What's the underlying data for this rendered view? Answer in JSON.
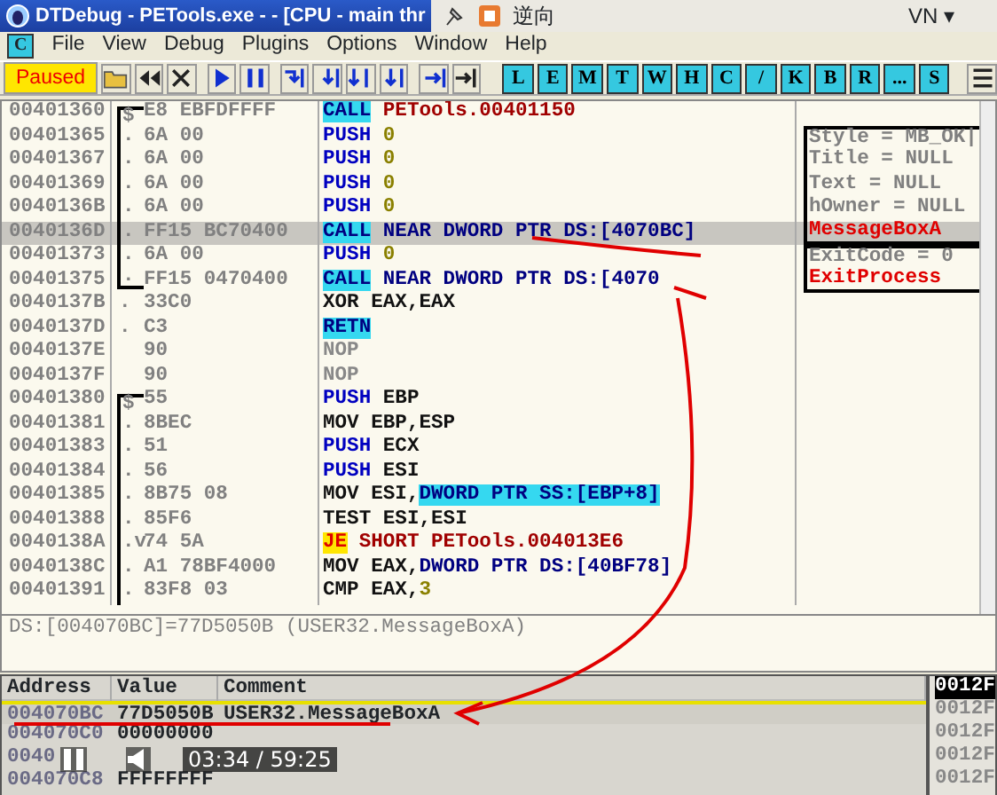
{
  "window": {
    "title": "DTDebug - PETools.exe - - [CPU - main thr",
    "overlay_tab": "逆向",
    "user_menu": "VN ▾"
  },
  "menu": [
    "File",
    "View",
    "Debug",
    "Plugins",
    "Options",
    "Window",
    "Help"
  ],
  "menu_logo": "C",
  "toolbar": {
    "status": "Paused",
    "letters": [
      "L",
      "E",
      "M",
      "T",
      "W",
      "H",
      "C",
      "/",
      "K",
      "B",
      "R",
      "...",
      "S"
    ]
  },
  "disassembly": [
    {
      "bracketed": true,
      "closed": true,
      "rows": [
        {
          "address": "00401360",
          "marker": "$",
          "hex": "E8 EBFDFFFF",
          "mnemonic": "CALL",
          "kind": "call",
          "operands": [
            {
              "text": "PETools.00401150",
              "kind": "label"
            }
          ],
          "selected": false
        },
        {
          "address": "00401365",
          "marker": ".",
          "hex": "6A 00",
          "mnemonic": "PUSH",
          "kind": "push",
          "operands": [
            {
              "text": "0",
              "kind": "imm"
            }
          ],
          "comment": {
            "text": "Style = MB_OK|",
            "kind": "arg"
          },
          "selected": false
        },
        {
          "address": "00401367",
          "marker": ".",
          "hex": "6A 00",
          "mnemonic": "PUSH",
          "kind": "push",
          "operands": [
            {
              "text": "0",
              "kind": "imm"
            }
          ],
          "comment": {
            "text": "Title = NULL",
            "kind": "arg"
          },
          "selected": false
        },
        {
          "address": "00401369",
          "marker": ".",
          "hex": "6A 00",
          "mnemonic": "PUSH",
          "kind": "push",
          "operands": [
            {
              "text": "0",
              "kind": "imm"
            }
          ],
          "comment": {
            "text": "Text = NULL",
            "kind": "arg"
          },
          "selected": false
        },
        {
          "address": "0040136B",
          "marker": ".",
          "hex": "6A 00",
          "mnemonic": "PUSH",
          "kind": "push",
          "operands": [
            {
              "text": "0",
              "kind": "imm"
            }
          ],
          "comment": {
            "text": "hOwner = NULL",
            "kind": "arg"
          },
          "selected": false
        },
        {
          "address": "0040136D",
          "marker": ".",
          "hex": "FF15 BC70400",
          "mnemonic": "CALL",
          "kind": "call",
          "operands": [
            {
              "text": "NEAR DWORD PTR DS:[4070BC]",
              "kind": "mem"
            }
          ],
          "comment": {
            "text": "MessageBoxA",
            "kind": "api"
          },
          "selected": true
        },
        {
          "address": "00401373",
          "marker": ".",
          "hex": "6A 00",
          "mnemonic": "PUSH",
          "kind": "push",
          "operands": [
            {
              "text": "0",
              "kind": "imm"
            }
          ],
          "comment": {
            "text": "ExitCode = 0",
            "kind": "arg"
          },
          "selected": false
        },
        {
          "address": "00401375",
          "marker": ".",
          "hex": "FF15 0470400",
          "mnemonic": "CALL",
          "kind": "call",
          "operands": [
            {
              "text": "NEAR DWORD PTR DS:[4070",
              "kind": "mem"
            }
          ],
          "comment": {
            "text": "ExitProcess",
            "kind": "api"
          },
          "selected": false
        }
      ]
    },
    {
      "bracketed": false,
      "rows": [
        {
          "address": "0040137B",
          "marker": ".",
          "hex": "33C0",
          "mnemonic": "XOR",
          "kind": "plain",
          "operands": [
            {
              "text": "EAX,EAX",
              "kind": "reg"
            }
          ],
          "selected": false
        },
        {
          "address": "0040137D",
          "marker": ".",
          "hex": "C3",
          "mnemonic": "RETN",
          "kind": "ret",
          "selected": false
        },
        {
          "address": "0040137E",
          "hex": "90",
          "mnemonic": "NOP",
          "kind": "nop",
          "selected": false
        },
        {
          "address": "0040137F",
          "hex": "90",
          "mnemonic": "NOP",
          "kind": "nop",
          "selected": false
        }
      ]
    },
    {
      "bracketed": true,
      "closed": false,
      "rows": [
        {
          "address": "00401380",
          "marker": "$",
          "hex": "55",
          "mnemonic": "PUSH",
          "kind": "push",
          "operands": [
            {
              "text": "EBP",
              "kind": "reg"
            }
          ],
          "selected": false
        },
        {
          "address": "00401381",
          "marker": ".",
          "hex": "8BEC",
          "mnemonic": "MOV",
          "kind": "plain",
          "operands": [
            {
              "text": "EBP,ESP",
              "kind": "reg"
            }
          ],
          "selected": false
        },
        {
          "address": "00401383",
          "marker": ".",
          "hex": "51",
          "mnemonic": "PUSH",
          "kind": "push",
          "operands": [
            {
              "text": "ECX",
              "kind": "reg"
            }
          ],
          "selected": false
        },
        {
          "address": "00401384",
          "marker": ".",
          "hex": "56",
          "mnemonic": "PUSH",
          "kind": "push",
          "operands": [
            {
              "text": "ESI",
              "kind": "reg"
            }
          ],
          "selected": false
        },
        {
          "address": "00401385",
          "marker": ".",
          "hex": "8B75 08",
          "mnemonic": "MOV",
          "kind": "plain",
          "operands": [
            {
              "text": "ESI,",
              "kind": "reg"
            },
            {
              "text": "DWORD PTR SS:[EBP+8]",
              "kind": "memhl"
            }
          ],
          "selected": false
        },
        {
          "address": "00401388",
          "marker": ".",
          "hex": "85F6",
          "mnemonic": "TEST",
          "kind": "plain",
          "operands": [
            {
              "text": "ESI,ESI",
              "kind": "reg"
            }
          ],
          "selected": false
        },
        {
          "address": "0040138A",
          "marker": ".v",
          "hex": "74 5A",
          "mnemonic": "JE",
          "kind": "jump",
          "operands": [
            {
              "text": "SHORT PETools.004013E6",
              "kind": "label"
            }
          ],
          "selected": false
        },
        {
          "address": "0040138C",
          "marker": ".",
          "hex": "A1 78BF4000",
          "mnemonic": "MOV",
          "kind": "plain",
          "operands": [
            {
              "text": "EAX,",
              "kind": "reg"
            },
            {
              "text": "DWORD PTR DS:[40BF78]",
              "kind": "mem"
            }
          ],
          "selected": false
        },
        {
          "address": "00401391",
          "marker": ".",
          "hex": "83F8 03",
          "mnemonic": "CMP",
          "kind": "plain",
          "operands": [
            {
              "text": "EAX,",
              "kind": "reg"
            },
            {
              "text": "3",
              "kind": "imm"
            }
          ],
          "selected": false
        }
      ]
    }
  ],
  "info_line": "DS:[004070BC]=77D5050B (USER32.MessageBoxA)",
  "dump": {
    "columns": [
      "Address",
      "Value",
      "Comment"
    ],
    "rows": [
      {
        "address": "004070BC",
        "value": "77D5050B",
        "comment": "USER32.MessageBoxA",
        "selected": true
      },
      {
        "address": "004070C0",
        "value": "00000000",
        "selected": false
      },
      {
        "address": "0040",
        "selected": false
      },
      {
        "address": "004070C8",
        "value": "FFFFFFFF",
        "selected": false
      }
    ]
  },
  "stack": [
    "0012F",
    "0012F",
    "0012F",
    "0012F",
    "0012F"
  ],
  "player": {
    "time": "03:34 / 59:25",
    "playing": true
  }
}
